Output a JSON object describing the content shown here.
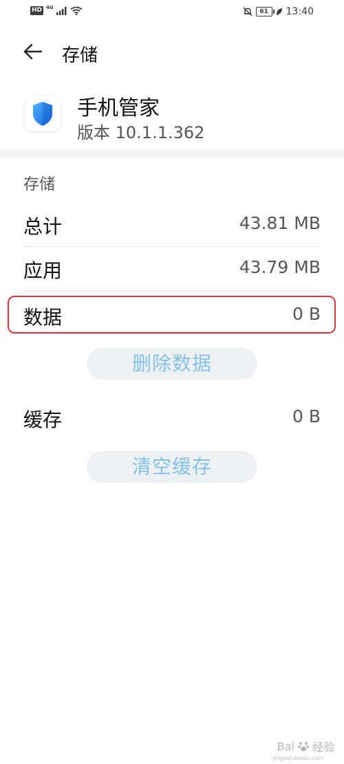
{
  "status_bar": {
    "hd": "HD",
    "network": "4G",
    "battery": "61",
    "time": "13:40"
  },
  "header": {
    "title": "存储"
  },
  "app": {
    "name": "手机管家",
    "version": "版本 10.1.1.362"
  },
  "section": {
    "label": "存储"
  },
  "rows": [
    {
      "label": "总计",
      "value": "43.81 MB"
    },
    {
      "label": "应用",
      "value": "43.79 MB"
    },
    {
      "label": "数据",
      "value": "0 B"
    },
    {
      "label": "缓存",
      "value": "0 B"
    }
  ],
  "buttons": {
    "delete_data": "删除数据",
    "clear_cache": "清空缓存"
  },
  "watermark": {
    "brand": "Bai",
    "brand2": "经验",
    "url": "jingyan.baidu.com"
  },
  "colors": {
    "accent_text": "#84c1e7",
    "highlight": "#d9343c",
    "shield": "#1e88e5"
  }
}
